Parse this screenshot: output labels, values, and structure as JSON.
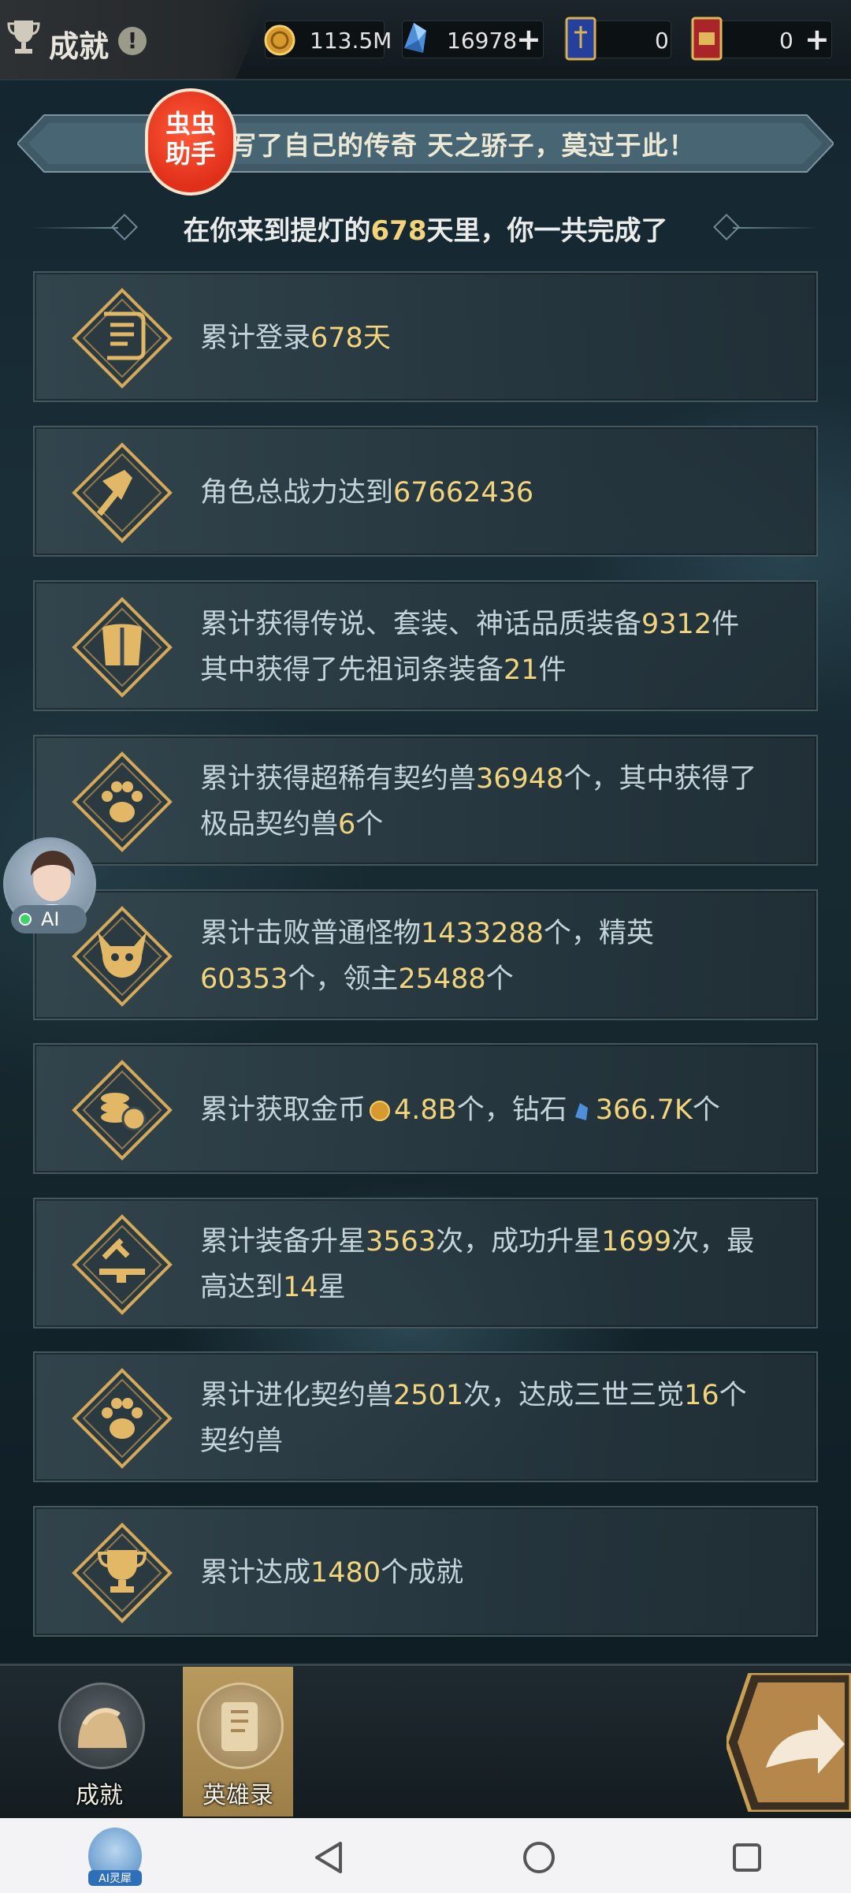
{
  "header": {
    "title": "成就",
    "info_icon": "!",
    "resources": [
      {
        "icon": "gold-coin-icon",
        "value": "113.5M"
      },
      {
        "icon": "diamond-icon",
        "value": "16978"
      },
      {
        "icon": "blue-card-icon",
        "value": "0"
      },
      {
        "icon": "red-card-icon",
        "value": "0"
      }
    ]
  },
  "banner": {
    "text": "，灯书写了自己的传奇 天之骄子，莫过于此！",
    "badge_line1": "虫虫",
    "badge_line2": "助手"
  },
  "subheading": {
    "before": "在你来到提灯的",
    "days": "678",
    "after": "天里，你一共完成了"
  },
  "achievements": [
    {
      "icon": "scroll-icon",
      "parts": [
        {
          "t": "累计登录"
        },
        {
          "t": "678天",
          "hl": true
        }
      ]
    },
    {
      "icon": "hammer-icon",
      "parts": [
        {
          "t": "角色总战力达到"
        },
        {
          "t": "67662436",
          "hl": true
        }
      ]
    },
    {
      "icon": "armor-icon",
      "parts": [
        {
          "t": "累计获得传说、套装、神话品质装备"
        },
        {
          "t": "9312",
          "hl": true
        },
        {
          "t": "件"
        },
        {
          "br": true
        },
        {
          "t": "其中获得了先祖词条装备"
        },
        {
          "t": "21",
          "hl": true
        },
        {
          "t": "件"
        }
      ]
    },
    {
      "icon": "paw-icon",
      "parts": [
        {
          "t": "累计获得超稀有契约兽"
        },
        {
          "t": "36948",
          "hl": true
        },
        {
          "t": "个，其中获得了"
        },
        {
          "br": true
        },
        {
          "t": "极品契约兽"
        },
        {
          "t": "6",
          "hl": true
        },
        {
          "t": "个"
        }
      ]
    },
    {
      "icon": "demon-icon",
      "parts": [
        {
          "t": "累计击败普通怪物"
        },
        {
          "t": "1433288",
          "hl": true
        },
        {
          "t": "个，精英"
        },
        {
          "br": true
        },
        {
          "t": "60353",
          "hl": true
        },
        {
          "t": "个，领主"
        },
        {
          "t": "25488",
          "hl": true
        },
        {
          "t": "个"
        }
      ]
    },
    {
      "icon": "coins-icon",
      "parts": [
        {
          "t": "累计获取金币"
        },
        {
          "mini": "gold"
        },
        {
          "t": "4.8B",
          "hl": true
        },
        {
          "t": "个，钻石"
        },
        {
          "mini": "diamond"
        },
        {
          "t": "366.7K",
          "hl": true
        },
        {
          "t": "个"
        }
      ]
    },
    {
      "icon": "anvil-icon",
      "parts": [
        {
          "t": "累计装备升星"
        },
        {
          "t": "3563",
          "hl": true
        },
        {
          "t": "次，成功升星"
        },
        {
          "t": "1699",
          "hl": true
        },
        {
          "t": "次，最"
        },
        {
          "br": true
        },
        {
          "t": "高达到"
        },
        {
          "t": "14",
          "hl": true
        },
        {
          "t": "星"
        }
      ]
    },
    {
      "icon": "paw-icon",
      "parts": [
        {
          "t": "累计进化契约兽"
        },
        {
          "t": "2501",
          "hl": true
        },
        {
          "t": "次，达成三世三觉"
        },
        {
          "t": "16",
          "hl": true
        },
        {
          "t": "个"
        },
        {
          "br": true
        },
        {
          "t": "契约兽"
        }
      ]
    },
    {
      "icon": "trophy-icon",
      "parts": [
        {
          "t": "累计达成"
        },
        {
          "t": "1480",
          "hl": true
        },
        {
          "t": "个成就"
        }
      ]
    }
  ],
  "floating_ai": {
    "label": "AI"
  },
  "tabs": [
    {
      "label": "成就",
      "active": false
    },
    {
      "label": "英雄录",
      "active": true
    }
  ],
  "navbar": {
    "assistant_label": "AI灵犀"
  },
  "colors": {
    "highlight": "#f2d47c",
    "gold": "#c9a052",
    "active_tab": "#b89a5e"
  }
}
